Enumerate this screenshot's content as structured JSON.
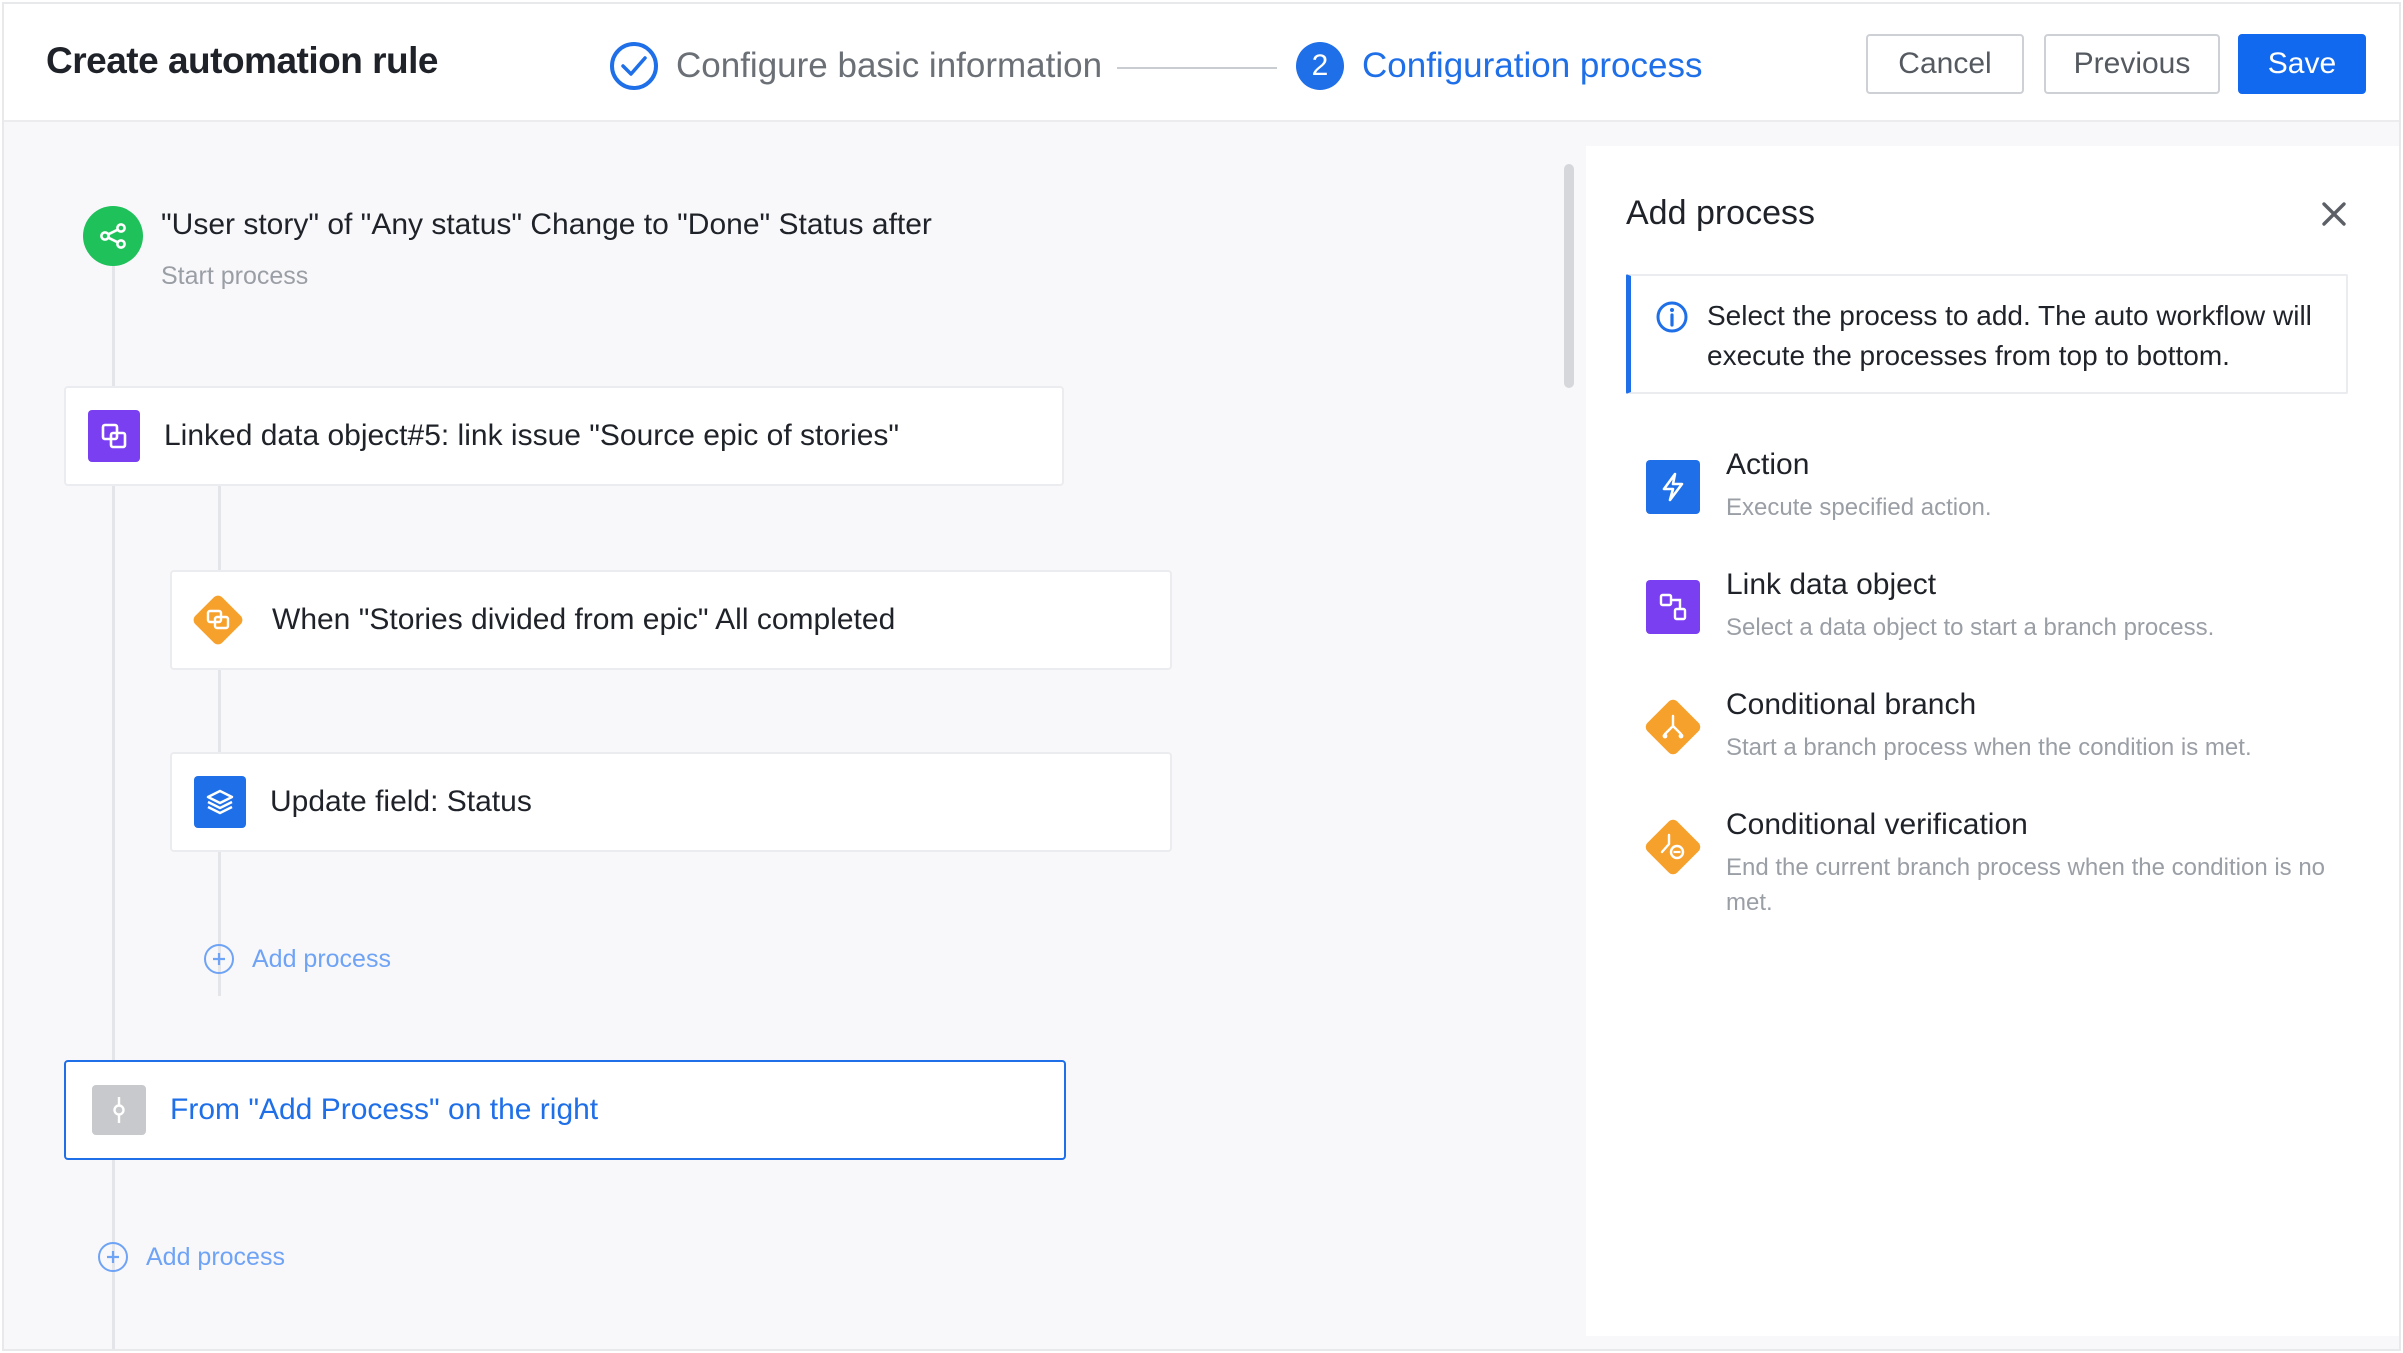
{
  "header": {
    "title": "Create automation rule",
    "steps": [
      {
        "number": "",
        "label": "Configure basic information",
        "state": "done"
      },
      {
        "number": "2",
        "label": "Configuration process",
        "state": "active"
      }
    ],
    "buttons": {
      "cancel": "Cancel",
      "previous": "Previous",
      "save": "Save"
    }
  },
  "canvas": {
    "start": {
      "title": "\"User story\" of \"Any status\" Change  to \"Done\" Status after",
      "subtitle": "Start process",
      "icon": "share-nodes-icon"
    },
    "nodes": [
      {
        "label": "Linked data object#5: link issue \"Source epic of stories\"",
        "icon": "link-object-icon",
        "icon_color": "#7b3ff2"
      },
      {
        "label": "When \"Stories divided from epic\" All completed",
        "icon": "condition-diamond-icon",
        "icon_color": "#f7a12d"
      },
      {
        "label": "Update field: Status",
        "icon": "layers-icon",
        "icon_color": "#1f6fe8"
      },
      {
        "label": "From \"Add Process\" on the right",
        "icon": "placeholder-node-icon",
        "icon_color": "#c8c9cc"
      }
    ],
    "add_process_inner": "Add process",
    "add_process_outer": "Add process"
  },
  "panel": {
    "title": "Add process",
    "info": "Select the process to add. The auto workflow will execute the processes from top to bottom.",
    "items": [
      {
        "title": "Action",
        "desc": "Execute specified action.",
        "icon": "lightning-icon",
        "color": "#1f6fe8"
      },
      {
        "title": "Link data object",
        "desc": "Select a data object to start a branch process.",
        "icon": "link-data-icon",
        "color": "#7b3ff2"
      },
      {
        "title": "Conditional branch",
        "desc": "Start a branch process when the condition is met.",
        "icon": "branch-icon",
        "color": "#f7a12d"
      },
      {
        "title": "Conditional verification",
        "desc": "End the current branch process when the condition is no met.",
        "icon": "verification-icon",
        "color": "#f7a12d"
      }
    ]
  },
  "colors": {
    "accent": "#1f6fe8",
    "start_green": "#1ec15a",
    "purple": "#7b3ff2",
    "orange": "#f7a12d"
  }
}
